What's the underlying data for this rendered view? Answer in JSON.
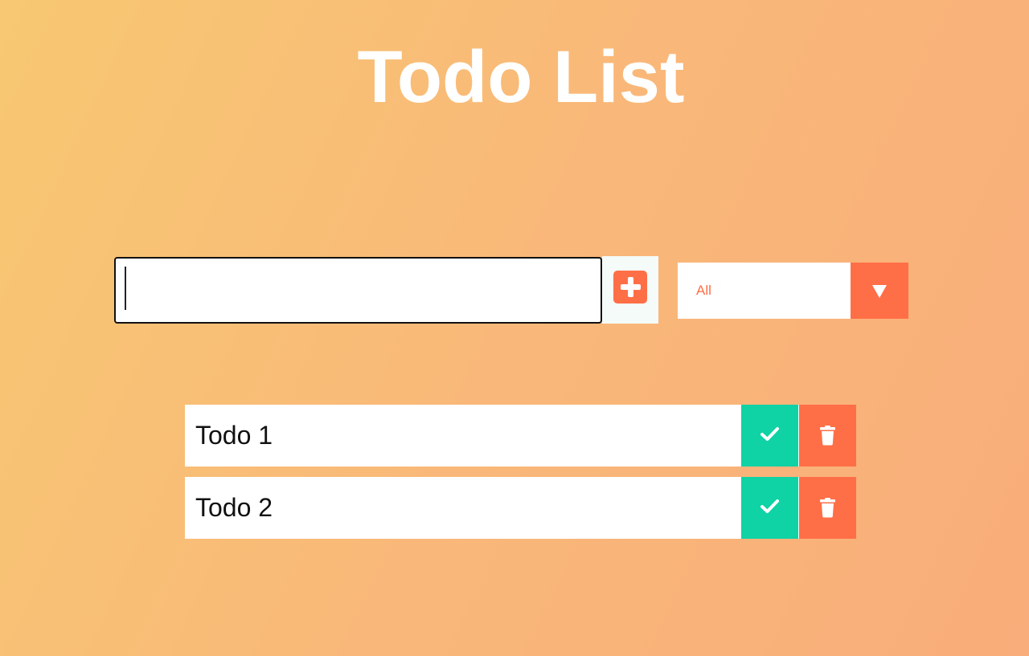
{
  "page": {
    "title": "Todo List"
  },
  "input": {
    "value": "",
    "placeholder": ""
  },
  "add_button": {
    "icon": "plus-square-icon"
  },
  "filter": {
    "selected": "All",
    "icon": "caret-down-icon"
  },
  "todos": [
    {
      "text": "Todo 1",
      "complete_icon": "check-icon",
      "delete_icon": "trash-icon"
    },
    {
      "text": "Todo 2",
      "complete_icon": "check-icon",
      "delete_icon": "trash-icon"
    }
  ],
  "colors": {
    "accent": "#ff6f47",
    "complete": "#0fd2a5",
    "background_start": "#f8c872",
    "background_end": "#f9ad7a"
  }
}
